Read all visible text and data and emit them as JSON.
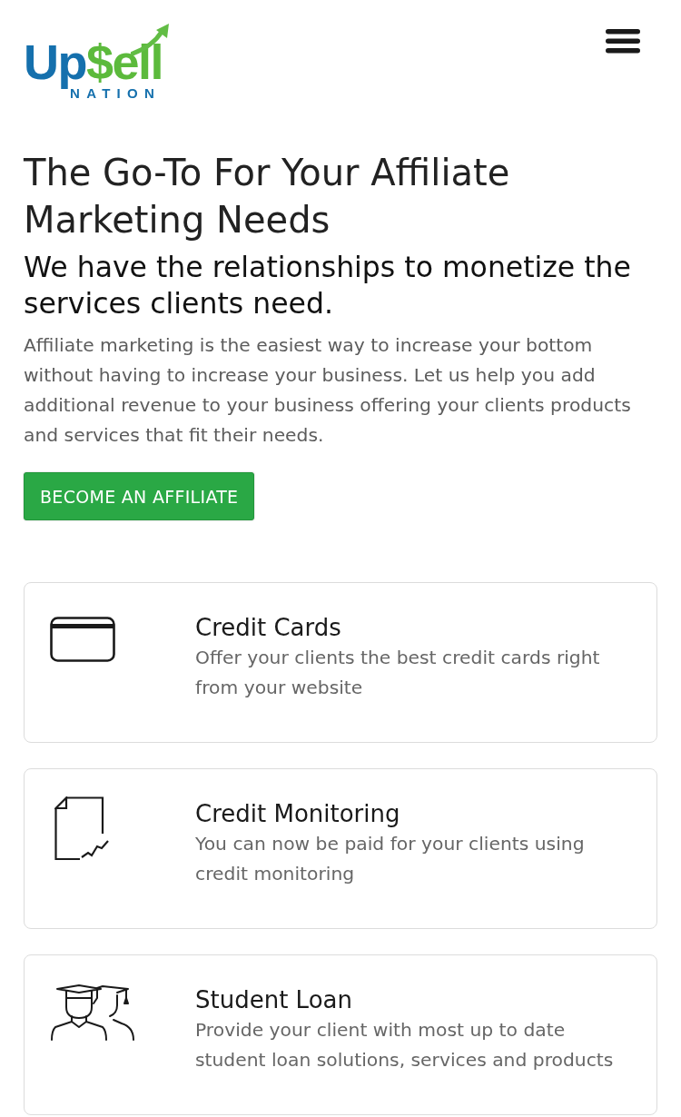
{
  "header": {
    "logo": {
      "wordmark": [
        "Up",
        "$ell"
      ],
      "subtitle": "NATION"
    }
  },
  "hero": {
    "title": "The Go-To For Your Affiliate Marketing Needs",
    "subtitle": "We have the relationships to monetize the services clients need.",
    "body": "Affiliate marketing is the easiest way to increase your bottom without having to increase your business. Let us help you add additional revenue to your business offering your clients products and services that fit their needs.",
    "button": "BECOME AN AFFILIATE"
  },
  "services": [
    {
      "kind": "card",
      "title": "Credit Cards",
      "description": "Offer your clients the best credit cards right from your website"
    },
    {
      "kind": "report",
      "title": "Credit Monitoring",
      "description": "You can now be paid for your clients using credit monitoring"
    },
    {
      "kind": "graduates",
      "title": "Student Loan",
      "description": "Provide your client with most up to date student loan solutions, services and products"
    }
  ]
}
